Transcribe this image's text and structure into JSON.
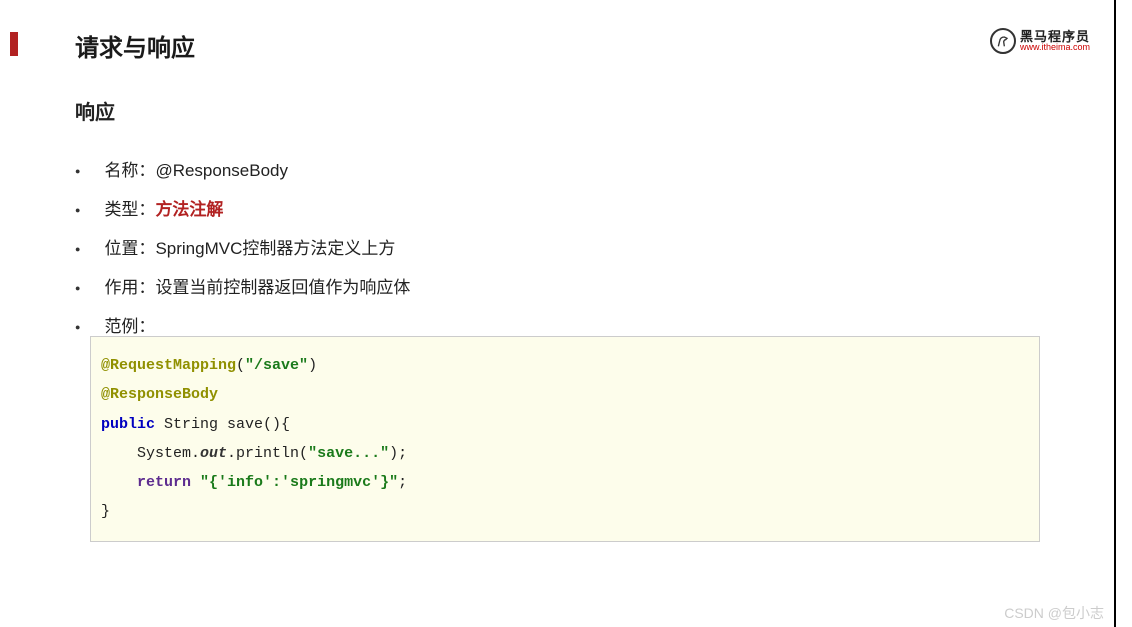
{
  "title": "请求与响应",
  "logo": {
    "main": "黑马程序员",
    "sub": "www.itheima.com"
  },
  "sectionTitle": "响应",
  "bullets": [
    {
      "label": "名称：",
      "value": "@ResponseBody"
    },
    {
      "label": "类型：",
      "value": "方法注解",
      "highlight": true
    },
    {
      "label": "位置：",
      "value": "SpringMVC控制器方法定义上方"
    },
    {
      "label": "作用：",
      "value": "设置当前控制器返回值作为响应体"
    },
    {
      "label": "范例：",
      "value": ""
    }
  ],
  "code": {
    "ann1": "@RequestMapping",
    "str1": "\"/save\"",
    "ann2": "@ResponseBody",
    "kwPublic": "public",
    "sig": " String save(){",
    "sysPre": "    System.",
    "out": "out",
    "println": ".println(",
    "str2": "\"save...\"",
    "printEnd": ");",
    "kwReturn": "return",
    "retPre": "    ",
    "str3": "\"{'info':'springmvc'}\"",
    "retEnd": ";",
    "close": "}"
  },
  "watermark": "CSDN @包小志"
}
